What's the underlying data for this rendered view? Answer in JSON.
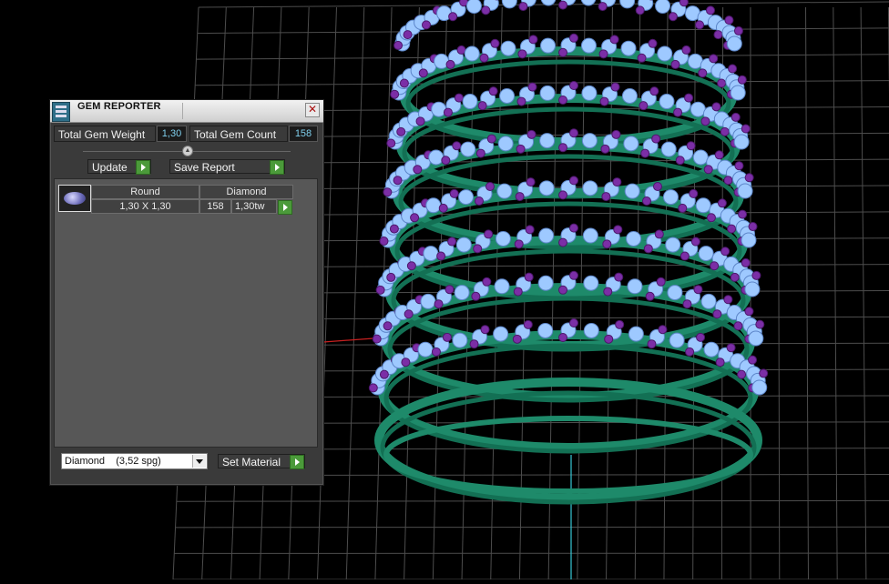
{
  "panel": {
    "title": "GEM REPORTER",
    "close_glyph": "✕",
    "total_weight_label": "Total Gem Weight",
    "total_weight_value": "1,30",
    "total_count_label": "Total Gem Count",
    "total_count_value": "158",
    "update_label": "Update",
    "save_report_label": "Save Report",
    "gem_table": {
      "headers": [
        "Round",
        "Diamond"
      ],
      "rows": [
        {
          "size": "1,30 X 1,30",
          "count": "158",
          "weight": "1,30tw"
        }
      ]
    },
    "material_select": {
      "value": "Diamond    (3,52 spg)"
    },
    "set_material_label": "Set Material"
  },
  "icons": [
    "app-icon",
    "close-icon",
    "divider-knob-icon",
    "play-icon",
    "dropdown-arrow-icon",
    "gem-round-icon"
  ],
  "colors": {
    "background": "#000000",
    "grid": "#4d4d4d",
    "ring_metal": "#1e8a6a",
    "gem_primary": "#9ec9ff",
    "gem_accent": "#7b2ea6",
    "value_text": "#7fd0ee",
    "button_green": "#4b9a3a"
  }
}
